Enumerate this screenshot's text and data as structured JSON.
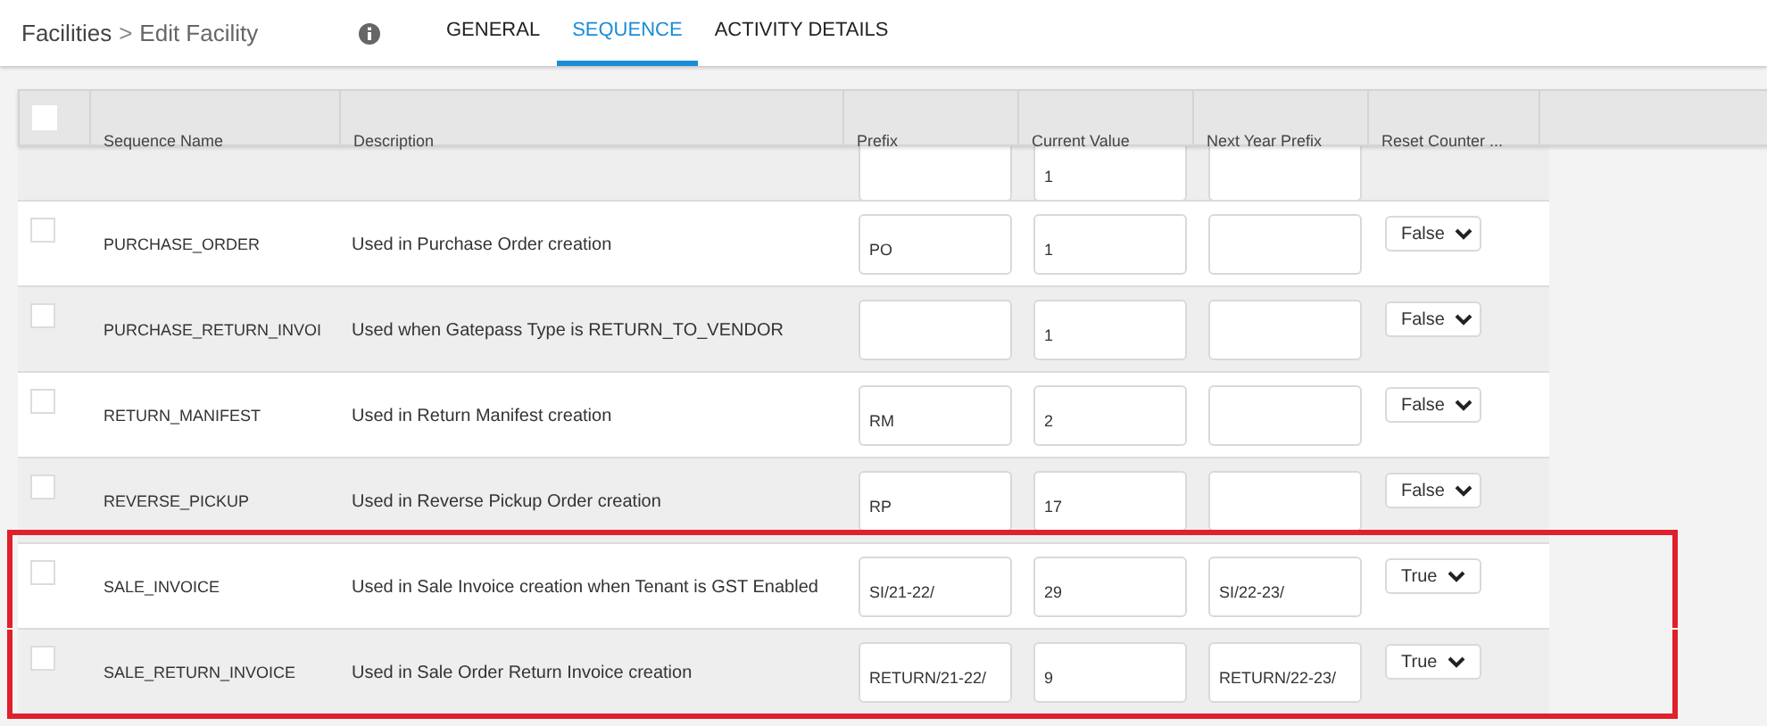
{
  "breadcrumb": {
    "parent": "Facilities",
    "separator": ">",
    "current": "Edit Facility"
  },
  "tabs": [
    {
      "label": "GENERAL",
      "selected": false
    },
    {
      "label": "SEQUENCE",
      "selected": true
    },
    {
      "label": "ACTIVITY DETAILS",
      "selected": false
    }
  ],
  "table": {
    "columns": [
      "Sequence Name",
      "Description",
      "Prefix",
      "Current Value",
      "Next Year Prefix",
      "Reset Counter ..."
    ],
    "all_checked": false,
    "partial_row": {
      "current_value": "1"
    },
    "rows": [
      {
        "name": "PURCHASE_ORDER",
        "description": "Used in Purchase Order creation",
        "prefix": "PO",
        "current_value": "1",
        "reset_counter": "False",
        "checked": false,
        "highlighted": false
      },
      {
        "name": "PURCHASE_RETURN_INVOI",
        "description": "Used when Gatepass Type is RETURN_TO_VENDOR",
        "current_value": "1",
        "reset_counter": "False",
        "checked": false,
        "highlighted": false
      },
      {
        "name": "RETURN_MANIFEST",
        "description": "Used in Return Manifest creation",
        "prefix": "RM",
        "current_value": "2",
        "reset_counter": "False",
        "checked": false,
        "highlighted": false
      },
      {
        "name": "REVERSE_PICKUP",
        "description": "Used in Reverse Pickup Order creation",
        "prefix": "RP",
        "current_value": "17",
        "reset_counter": "False",
        "checked": false,
        "highlighted": false
      },
      {
        "name": "SALE_INVOICE",
        "description": "Used in Sale Invoice creation when Tenant is GST Enabled",
        "prefix": "SI/21-22/",
        "current_value": "29",
        "next_year_prefix": "SI/22-23/",
        "reset_counter": "True",
        "checked": false,
        "highlighted": true
      },
      {
        "name": "SALE_RETURN_INVOICE",
        "description": "Used in Sale Order Return Invoice creation",
        "prefix": "RETURN/21-22/",
        "current_value": "9",
        "next_year_prefix": "RETURN/22-23/",
        "reset_counter": "True",
        "checked": false,
        "highlighted": true
      }
    ]
  }
}
